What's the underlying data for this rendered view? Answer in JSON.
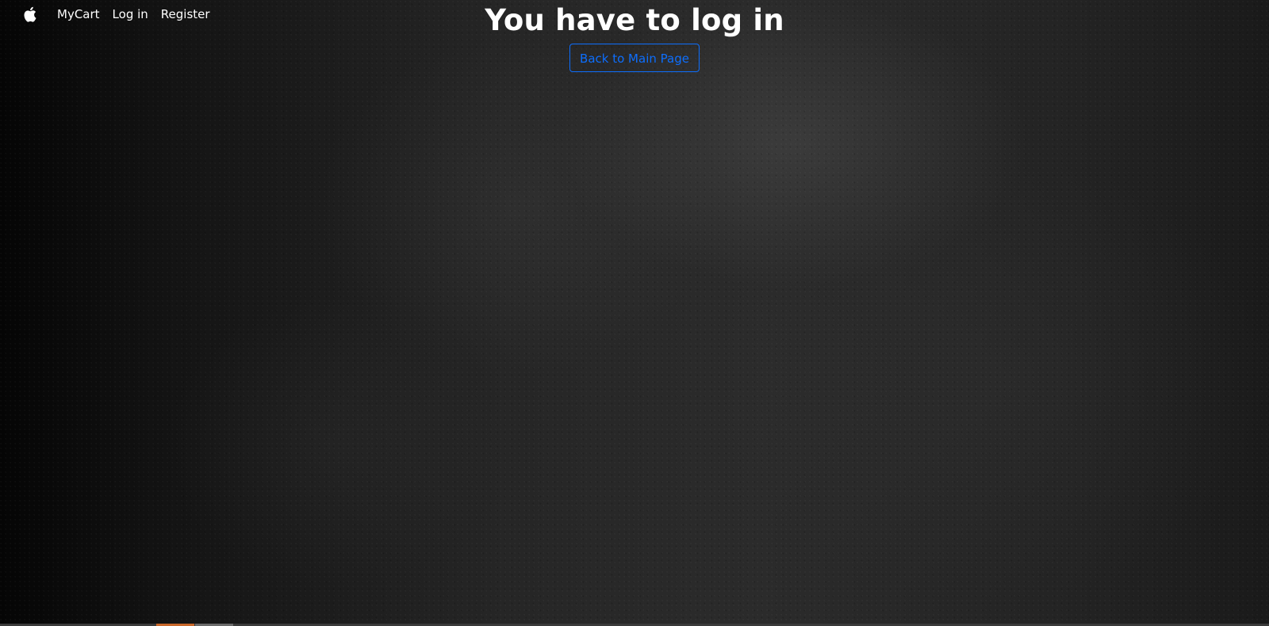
{
  "navbar": {
    "brand_icon": "apple-logo-icon",
    "links": [
      {
        "label": "MyCart"
      },
      {
        "label": "Log in"
      },
      {
        "label": "Register"
      }
    ]
  },
  "main": {
    "title": "You have to log in",
    "back_button_label": "Back to Main Page"
  },
  "colors": {
    "button_accent": "#0d6efd",
    "text": "#ffffff",
    "background": "#1b1b1b"
  }
}
